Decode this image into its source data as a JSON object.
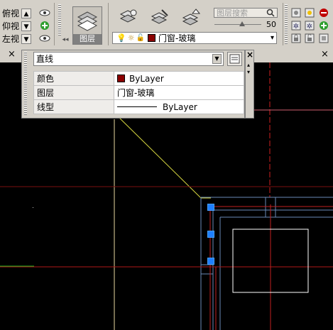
{
  "toolbar": {
    "views": [
      {
        "label": "俯视"
      },
      {
        "label": "仰视"
      },
      {
        "label": "左视"
      }
    ],
    "layer_button_label": "图层",
    "layer_search_placeholder": "图层搜索",
    "zoom_value": "50",
    "current_layer": "门窗-玻璃",
    "accent_color": "#8b0000"
  },
  "tabs": {
    "close_glyph": "×"
  },
  "properties": {
    "object_type": "直线",
    "rows": [
      {
        "key": "颜色",
        "value": "ByLayer"
      },
      {
        "key": "图层",
        "value": "门窗-玻璃"
      },
      {
        "key": "线型",
        "value": "ByLayer"
      }
    ],
    "close_glyph": "×"
  },
  "canvas": {
    "background_color": "#000000"
  }
}
